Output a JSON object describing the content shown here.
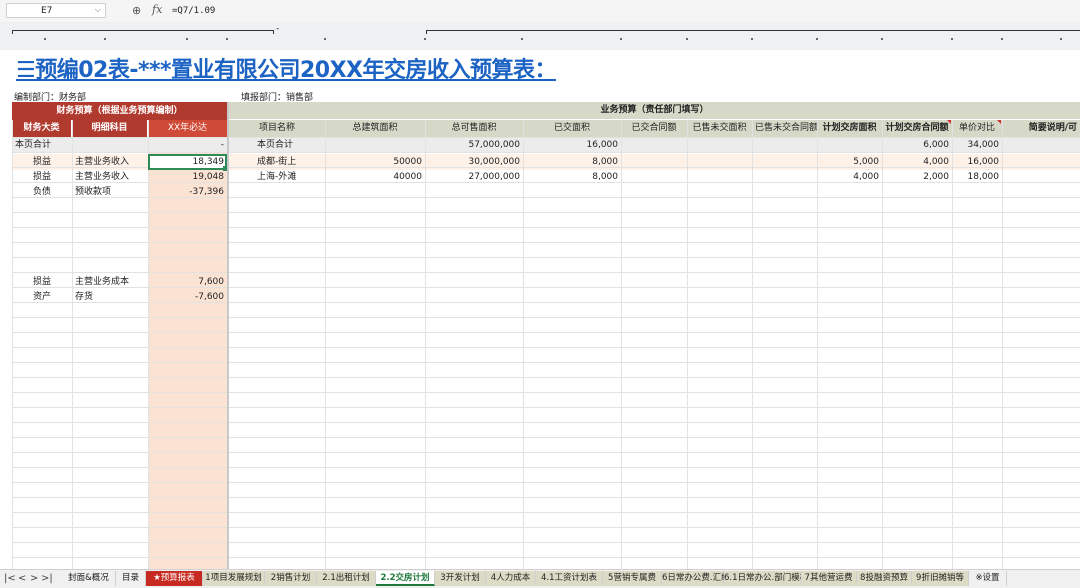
{
  "formula_bar": {
    "cell_ref": "E7",
    "formula": "=Q7/1.09"
  },
  "title": "☰预编02表-***置业有限公司20XX年交房收入预算表：",
  "meta": {
    "left": "编制部门：财务部",
    "right": "填报部门：销售部"
  },
  "finance_header": {
    "group": "财务预算（根据业务预算编制）",
    "cols": [
      "财务大类",
      "明细科目",
      "XX年必达"
    ]
  },
  "business_header": {
    "group": "业务预算（责任部门填写）",
    "cols": [
      "项目名称",
      "总建筑面积",
      "总可售面积",
      "已交面积",
      "已交合同额",
      "已售未交面积",
      "已售未交合同额",
      "计划交房面积",
      "计划交房合同额",
      "单价对比",
      "简要说明/可"
    ]
  },
  "finance_rows": [
    {
      "cat": "本页合计",
      "item": "",
      "val": "-"
    },
    {
      "cat": "损益",
      "item": "主营业务收入",
      "val": "18,349"
    },
    {
      "cat": "损益",
      "item": "主营业务收入",
      "val": "19,048"
    },
    {
      "cat": "负债",
      "item": "预收款项",
      "val": "-37,396"
    },
    {
      "cat": "",
      "item": "",
      "val": ""
    },
    {
      "cat": "",
      "item": "",
      "val": ""
    },
    {
      "cat": "",
      "item": "",
      "val": ""
    },
    {
      "cat": "",
      "item": "",
      "val": ""
    },
    {
      "cat": "",
      "item": "",
      "val": ""
    },
    {
      "cat": "损益",
      "item": "主营业务成本",
      "val": "7,600"
    },
    {
      "cat": "资产",
      "item": "存货",
      "val": "-7,600"
    }
  ],
  "business_rows": [
    {
      "name": "本页合计",
      "total_area": "",
      "saleable": "57,000,000",
      "delivered": "16,000",
      "delivered_amt": "",
      "sold_undelivered": "",
      "sold_undelivered_amt": "",
      "plan_area": "",
      "plan_amt": "6,000",
      "price": "34,000"
    },
    {
      "name": "成都-街上",
      "total_area": "50000",
      "saleable": "30,000,000",
      "delivered": "8,000",
      "delivered_amt": "",
      "sold_undelivered": "",
      "sold_undelivered_amt": "",
      "plan_area": "5,000",
      "plan_amt": "4,000",
      "price": "16,000"
    },
    {
      "name": "上海-外滩",
      "total_area": "40000",
      "saleable": "27,000,000",
      "delivered": "8,000",
      "delivered_amt": "",
      "sold_undelivered": "",
      "sold_undelivered_amt": "",
      "plan_area": "4,000",
      "plan_amt": "2,000",
      "price": "18,000"
    }
  ],
  "tabs": [
    {
      "label": "封面&概况",
      "style": "normal"
    },
    {
      "label": "目录",
      "style": "normal"
    },
    {
      "label": "★预算报表",
      "style": "red"
    },
    {
      "label": "1项目发展规划",
      "style": "olive"
    },
    {
      "label": "2销售计划",
      "style": "olive"
    },
    {
      "label": "2.1出租计划",
      "style": "olive"
    },
    {
      "label": "2.2交房计划",
      "style": "active"
    },
    {
      "label": "3开发计划",
      "style": "olive"
    },
    {
      "label": "4人力成本",
      "style": "olive"
    },
    {
      "label": "4.1工资计划表",
      "style": "olive"
    },
    {
      "label": "5营销专属费",
      "style": "olive"
    },
    {
      "label": "6日常办公费.汇编",
      "style": "olive"
    },
    {
      "label": "6.1日常办公.部门模板",
      "style": "olive"
    },
    {
      "label": "7其他营运费",
      "style": "olive"
    },
    {
      "label": "8投融资预算",
      "style": "olive"
    },
    {
      "label": "9折旧摊销等",
      "style": "olive"
    },
    {
      "label": "※设置",
      "style": "normal"
    }
  ],
  "colors": {
    "accent_red": "#b13a2f",
    "header_green": "#d7d9c8",
    "title_blue": "#1c63c4",
    "col_highlight": "#fbe3d4",
    "selected_row": "#fdf1e8"
  }
}
